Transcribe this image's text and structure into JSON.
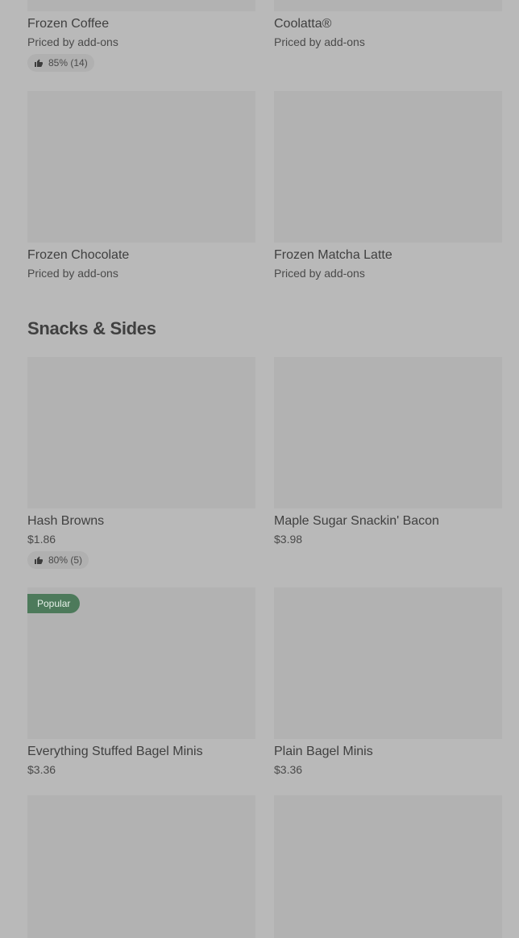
{
  "top_row": [
    {
      "name": "Frozen Coffee",
      "sub": "Priced by add-ons",
      "rating": "85% (14)"
    },
    {
      "name": "Coolatta®",
      "sub": "Priced by add-ons"
    }
  ],
  "row2": [
    {
      "name": "Frozen Chocolate",
      "sub": "Priced by add-ons"
    },
    {
      "name": "Frozen Matcha Latte",
      "sub": "Priced by add-ons"
    }
  ],
  "section": {
    "title": "Snacks & Sides"
  },
  "row3": [
    {
      "name": "Hash Browns",
      "price": "$1.86",
      "rating": "80% (5)"
    },
    {
      "name": "Maple Sugar Snackin' Bacon",
      "price": "$3.98"
    }
  ],
  "row4": [
    {
      "badge": "Popular",
      "name": "Everything Stuffed Bagel Minis",
      "price": "$3.36"
    },
    {
      "name": "Plain Bagel Minis",
      "price": "$3.36"
    }
  ],
  "icons": {
    "rating": "thumbs-up-icon"
  },
  "colors": {
    "badge": "#4d7a5b",
    "background": "#b9b9b9",
    "image_placeholder": "#b2b2b2"
  }
}
